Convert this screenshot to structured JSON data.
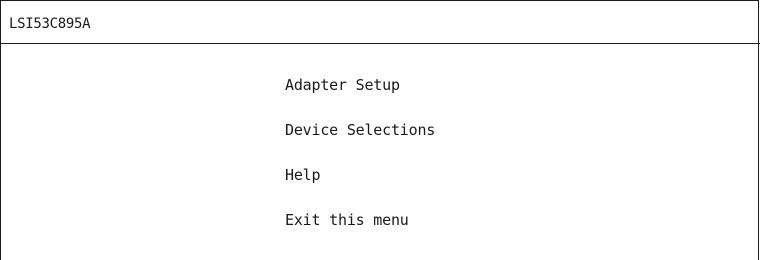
{
  "header": {
    "title": "LSI53C895A"
  },
  "menu": {
    "items": [
      {
        "label": "Adapter Setup"
      },
      {
        "label": "Device Selections"
      },
      {
        "label": "Help"
      },
      {
        "label": "Exit this menu"
      }
    ]
  },
  "colors": {
    "background": "#ffffff",
    "text": "#1a1a1a",
    "border": "#1a1a1a"
  }
}
